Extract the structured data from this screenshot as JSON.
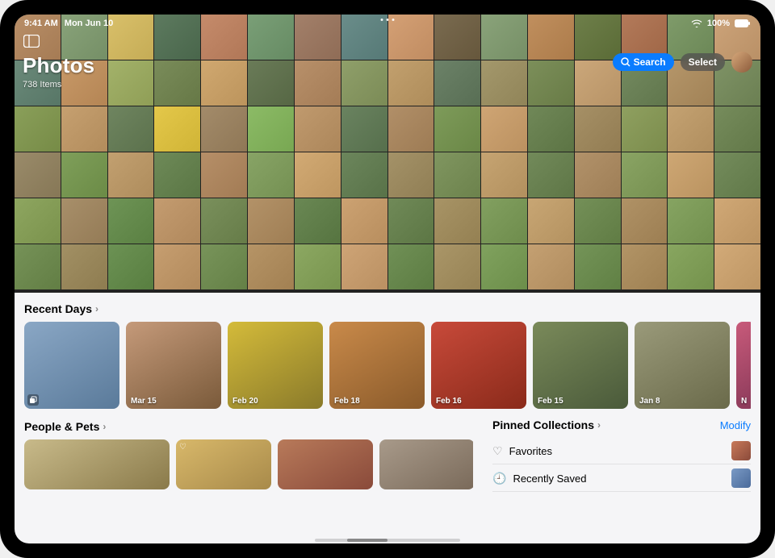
{
  "status": {
    "time": "9:41 AM",
    "date": "Mon Jun 10",
    "battery": "100%"
  },
  "header": {
    "title": "Photos",
    "item_count": "738 Items",
    "search_label": "Search",
    "select_label": "Select"
  },
  "grid_colors": [
    "#b98f68",
    "#89a37a",
    "#d9c06a",
    "#5d7a5f",
    "#c58b6b",
    "#7a9f77",
    "#a3806a",
    "#6a8d8a",
    "#d4a075",
    "#7a6b50",
    "#8aa37a",
    "#c08f5e",
    "#6e7f4a",
    "#b37a5a",
    "#7f9b6a",
    "#cda47a",
    "#6b8a7a",
    "#c89968",
    "#a3b26a",
    "#7a8c5a",
    "#d0a870",
    "#6a7b58",
    "#b8906a",
    "#8f9f6a",
    "#c2a06e",
    "#6c8268",
    "#a4986c",
    "#7c8f5a",
    "#cba77a",
    "#748a60",
    "#b5966a",
    "#7f9366",
    "#8a9f5a",
    "#c6a070",
    "#6f8560",
    "#e4c84a",
    "#a38b6a",
    "#8cbb66",
    "#c09a6e",
    "#6a8360",
    "#b18f68",
    "#7e9b5a",
    "#cfa574",
    "#708858",
    "#a69066",
    "#8fa060",
    "#c4a272",
    "#768c5c",
    "#9a8b6a",
    "#7f9f5a",
    "#c2a070",
    "#6e8a58",
    "#b68f68",
    "#88a466",
    "#d2aa74",
    "#6c865c",
    "#a49268",
    "#809660",
    "#c6a472",
    "#728a5a",
    "#b2926a",
    "#8aa464",
    "#cea774",
    "#748c5c",
    "#8ea660",
    "#a88f6a",
    "#6e9456",
    "#c49c70",
    "#7a905c",
    "#b39268",
    "#6a8854",
    "#cca272",
    "#708a58",
    "#a89466",
    "#82a060",
    "#c8a674",
    "#749058",
    "#b09266",
    "#86a462",
    "#d0a876",
    "#769258",
    "#a29064",
    "#6c9254",
    "#c69e70",
    "#78945a",
    "#b69466",
    "#8ca862",
    "#cea476",
    "#709056",
    "#aa9668",
    "#80a25e",
    "#c4a072",
    "#749458",
    "#b29466",
    "#88a660",
    "#d2aa78"
  ],
  "recent_days": {
    "title": "Recent Days",
    "items": [
      {
        "label": "",
        "has_badge": true,
        "color1": "#8aa7c5",
        "color2": "#5a7a9a"
      },
      {
        "label": "Mar 15",
        "color1": "#c59a7a",
        "color2": "#7a5a3a"
      },
      {
        "label": "Feb 20",
        "color1": "#d4bb3a",
        "color2": "#8a7a2a"
      },
      {
        "label": "Feb 18",
        "color1": "#c98a4a",
        "color2": "#8a5a2a"
      },
      {
        "label": "Feb 16",
        "color1": "#c84a3a",
        "color2": "#8a2a1a"
      },
      {
        "label": "Feb 15",
        "color1": "#7a8a5a",
        "color2": "#4a5a3a"
      },
      {
        "label": "Jan 8",
        "color1": "#9a9a7a",
        "color2": "#6a6a4a"
      },
      {
        "label": "N",
        "color1": "#c85a7a",
        "color2": "#8a3a5a",
        "peek": true
      }
    ]
  },
  "people_pets": {
    "title": "People & Pets",
    "items": [
      {
        "label": "",
        "wide": true,
        "color1": "#c8ba8a",
        "color2": "#8a7a4a"
      },
      {
        "label": "",
        "color1": "#d8b86a",
        "color2": "#a88a4a",
        "heart": true
      },
      {
        "label": "",
        "color1": "#b87a5a",
        "color2": "#8a4a3a"
      },
      {
        "label": "",
        "color1": "#a89a8a",
        "color2": "#7a6a5a"
      }
    ]
  },
  "pinned": {
    "title": "Pinned Collections",
    "modify_label": "Modify",
    "rows": [
      {
        "icon": "heart",
        "label": "Favorites",
        "swatch1": "#c87a5a",
        "swatch2": "#8a4a3a"
      },
      {
        "icon": "bookmark",
        "label": "Recently Saved",
        "swatch1": "#7a9ac5",
        "swatch2": "#4a6a9a"
      }
    ]
  }
}
